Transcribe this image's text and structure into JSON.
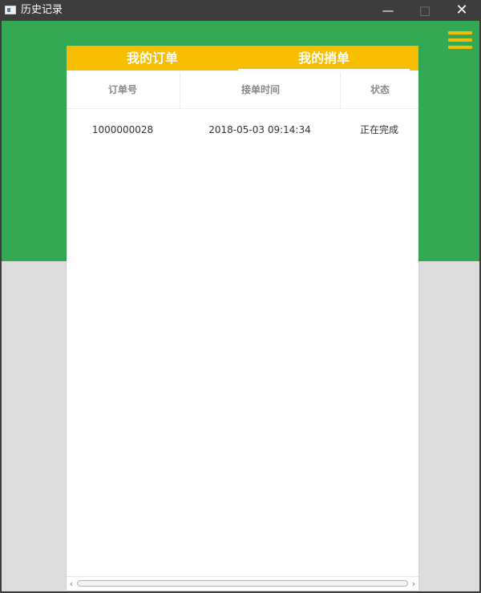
{
  "window": {
    "title": "历史记录",
    "controls": {
      "minimize": "—",
      "maximize": "□",
      "close": "✕"
    }
  },
  "colors": {
    "green_header": "#33a954",
    "tab_yellow": "#f7bd00",
    "menu_yellow": "#f5bc00",
    "background": "#dddddd"
  },
  "menu": {
    "icon": "hamburger-menu-icon"
  },
  "tabs": [
    {
      "label": "我的订单",
      "selected": false
    },
    {
      "label": "我的捎单",
      "selected": true
    }
  ],
  "table": {
    "headers": [
      "订单号",
      "接单时间",
      "状态"
    ],
    "rows": [
      [
        "1000000028",
        "2018-05-03 09:14:34",
        "正在完成"
      ]
    ]
  },
  "scrollbar": {
    "left_arrow": "‹",
    "right_arrow": "›"
  }
}
